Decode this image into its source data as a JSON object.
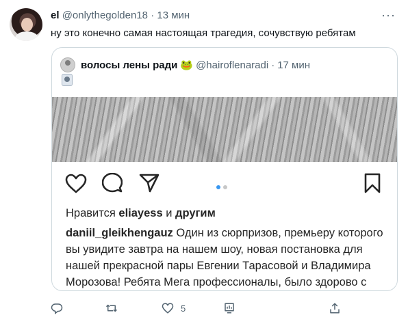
{
  "tweet": {
    "author_name": "el",
    "author_handle": "@onlythegolden18",
    "separator": "·",
    "time": "13 мин",
    "more": "···",
    "text": "ну это конечно самая настоящая трагедия, сочувствую ребятам"
  },
  "quote": {
    "author_name": "волосы лены ради",
    "author_emoji": "🐸",
    "author_handle": "@hairoflenaradi",
    "separator": "·",
    "time": "17 мин",
    "ig": {
      "likes_prefix": "Нравится",
      "likes_user": "eliayess",
      "likes_and": "и",
      "likes_others": "другим",
      "caption_user": "daniil_gleikhengauz",
      "caption_text": "Один из сюрпризов, премьеру которого вы увидите завтра на нашем шоу, новая постановка для нашей прекрасной пары Евгении Тарасовой и Владимира Морозова! Ребята Мега профессионалы, было здорово с"
    }
  },
  "actions": {
    "like_count": "5"
  },
  "colors": {
    "text": "#0f1419",
    "secondary": "#536471",
    "border": "#cfd9de",
    "carousel_active": "#3897f0",
    "carousel_inactive": "#c7c7c7"
  }
}
